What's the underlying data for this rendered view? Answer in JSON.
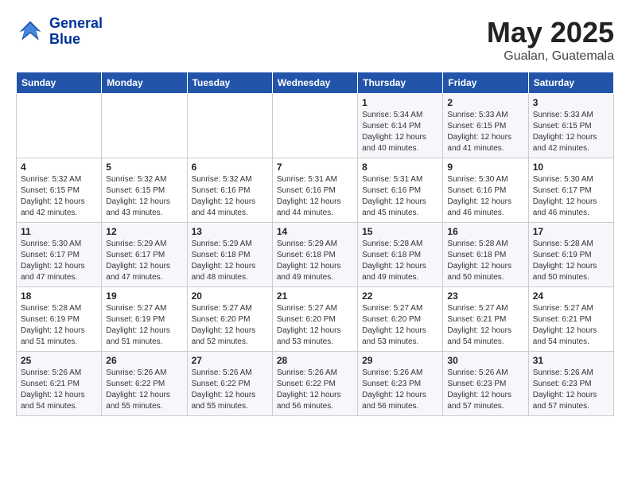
{
  "header": {
    "logo_line1": "General",
    "logo_line2": "Blue",
    "month": "May 2025",
    "location": "Gualan, Guatemala"
  },
  "days_of_week": [
    "Sunday",
    "Monday",
    "Tuesday",
    "Wednesday",
    "Thursday",
    "Friday",
    "Saturday"
  ],
  "weeks": [
    [
      {
        "day": "",
        "info": ""
      },
      {
        "day": "",
        "info": ""
      },
      {
        "day": "",
        "info": ""
      },
      {
        "day": "",
        "info": ""
      },
      {
        "day": "1",
        "info": "Sunrise: 5:34 AM\nSunset: 6:14 PM\nDaylight: 12 hours\nand 40 minutes."
      },
      {
        "day": "2",
        "info": "Sunrise: 5:33 AM\nSunset: 6:15 PM\nDaylight: 12 hours\nand 41 minutes."
      },
      {
        "day": "3",
        "info": "Sunrise: 5:33 AM\nSunset: 6:15 PM\nDaylight: 12 hours\nand 42 minutes."
      }
    ],
    [
      {
        "day": "4",
        "info": "Sunrise: 5:32 AM\nSunset: 6:15 PM\nDaylight: 12 hours\nand 42 minutes."
      },
      {
        "day": "5",
        "info": "Sunrise: 5:32 AM\nSunset: 6:15 PM\nDaylight: 12 hours\nand 43 minutes."
      },
      {
        "day": "6",
        "info": "Sunrise: 5:32 AM\nSunset: 6:16 PM\nDaylight: 12 hours\nand 44 minutes."
      },
      {
        "day": "7",
        "info": "Sunrise: 5:31 AM\nSunset: 6:16 PM\nDaylight: 12 hours\nand 44 minutes."
      },
      {
        "day": "8",
        "info": "Sunrise: 5:31 AM\nSunset: 6:16 PM\nDaylight: 12 hours\nand 45 minutes."
      },
      {
        "day": "9",
        "info": "Sunrise: 5:30 AM\nSunset: 6:16 PM\nDaylight: 12 hours\nand 46 minutes."
      },
      {
        "day": "10",
        "info": "Sunrise: 5:30 AM\nSunset: 6:17 PM\nDaylight: 12 hours\nand 46 minutes."
      }
    ],
    [
      {
        "day": "11",
        "info": "Sunrise: 5:30 AM\nSunset: 6:17 PM\nDaylight: 12 hours\nand 47 minutes."
      },
      {
        "day": "12",
        "info": "Sunrise: 5:29 AM\nSunset: 6:17 PM\nDaylight: 12 hours\nand 47 minutes."
      },
      {
        "day": "13",
        "info": "Sunrise: 5:29 AM\nSunset: 6:18 PM\nDaylight: 12 hours\nand 48 minutes."
      },
      {
        "day": "14",
        "info": "Sunrise: 5:29 AM\nSunset: 6:18 PM\nDaylight: 12 hours\nand 49 minutes."
      },
      {
        "day": "15",
        "info": "Sunrise: 5:28 AM\nSunset: 6:18 PM\nDaylight: 12 hours\nand 49 minutes."
      },
      {
        "day": "16",
        "info": "Sunrise: 5:28 AM\nSunset: 6:18 PM\nDaylight: 12 hours\nand 50 minutes."
      },
      {
        "day": "17",
        "info": "Sunrise: 5:28 AM\nSunset: 6:19 PM\nDaylight: 12 hours\nand 50 minutes."
      }
    ],
    [
      {
        "day": "18",
        "info": "Sunrise: 5:28 AM\nSunset: 6:19 PM\nDaylight: 12 hours\nand 51 minutes."
      },
      {
        "day": "19",
        "info": "Sunrise: 5:27 AM\nSunset: 6:19 PM\nDaylight: 12 hours\nand 51 minutes."
      },
      {
        "day": "20",
        "info": "Sunrise: 5:27 AM\nSunset: 6:20 PM\nDaylight: 12 hours\nand 52 minutes."
      },
      {
        "day": "21",
        "info": "Sunrise: 5:27 AM\nSunset: 6:20 PM\nDaylight: 12 hours\nand 53 minutes."
      },
      {
        "day": "22",
        "info": "Sunrise: 5:27 AM\nSunset: 6:20 PM\nDaylight: 12 hours\nand 53 minutes."
      },
      {
        "day": "23",
        "info": "Sunrise: 5:27 AM\nSunset: 6:21 PM\nDaylight: 12 hours\nand 54 minutes."
      },
      {
        "day": "24",
        "info": "Sunrise: 5:27 AM\nSunset: 6:21 PM\nDaylight: 12 hours\nand 54 minutes."
      }
    ],
    [
      {
        "day": "25",
        "info": "Sunrise: 5:26 AM\nSunset: 6:21 PM\nDaylight: 12 hours\nand 54 minutes."
      },
      {
        "day": "26",
        "info": "Sunrise: 5:26 AM\nSunset: 6:22 PM\nDaylight: 12 hours\nand 55 minutes."
      },
      {
        "day": "27",
        "info": "Sunrise: 5:26 AM\nSunset: 6:22 PM\nDaylight: 12 hours\nand 55 minutes."
      },
      {
        "day": "28",
        "info": "Sunrise: 5:26 AM\nSunset: 6:22 PM\nDaylight: 12 hours\nand 56 minutes."
      },
      {
        "day": "29",
        "info": "Sunrise: 5:26 AM\nSunset: 6:23 PM\nDaylight: 12 hours\nand 56 minutes."
      },
      {
        "day": "30",
        "info": "Sunrise: 5:26 AM\nSunset: 6:23 PM\nDaylight: 12 hours\nand 57 minutes."
      },
      {
        "day": "31",
        "info": "Sunrise: 5:26 AM\nSunset: 6:23 PM\nDaylight: 12 hours\nand 57 minutes."
      }
    ]
  ]
}
